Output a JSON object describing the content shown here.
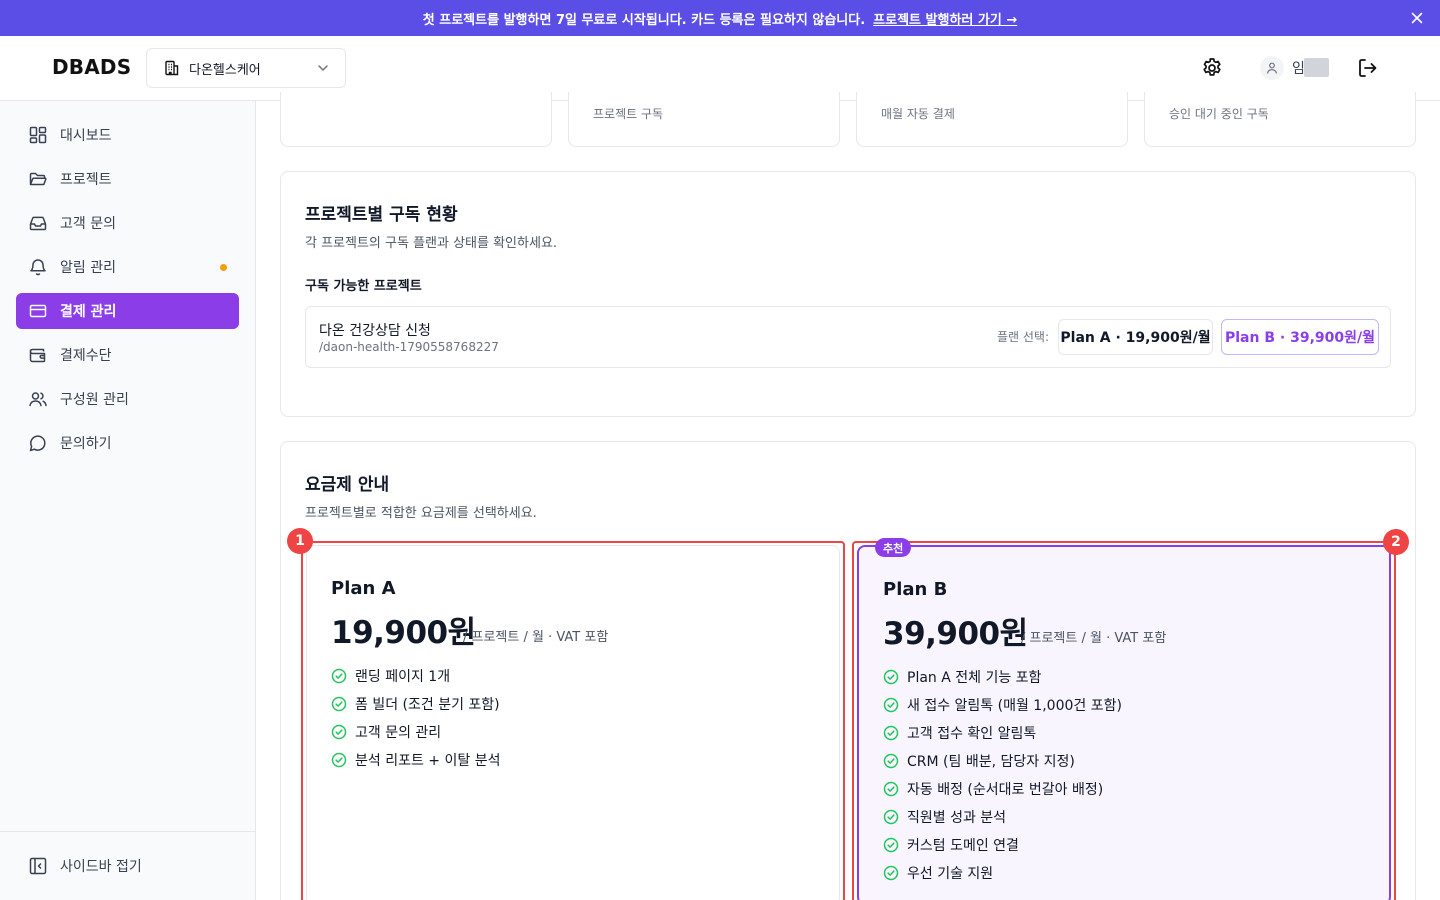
{
  "banner": {
    "text": "첫 프로젝트를 발행하면 7일 무료로 시작됩니다. 카드 등록은 필요하지 않습니다.",
    "link": "프로젝트 발행하러 가기 →",
    "close_icon": "close-icon"
  },
  "header": {
    "logo": "DBADS",
    "org_name": "다온헬스케어",
    "user_initial": "임"
  },
  "sidebar": {
    "items": [
      {
        "label": "대시보드",
        "icon": "dashboard-icon"
      },
      {
        "label": "프로젝트",
        "icon": "folder-icon"
      },
      {
        "label": "고객 문의",
        "icon": "inbox-icon"
      },
      {
        "label": "알림 관리",
        "icon": "bell-icon"
      },
      {
        "label": "결제 관리",
        "icon": "credit-card-icon"
      },
      {
        "label": "결제수단",
        "icon": "wallet-icon"
      },
      {
        "label": "구성원 관리",
        "icon": "users-icon"
      },
      {
        "label": "문의하기",
        "icon": "chat-icon"
      }
    ],
    "active_index": 4,
    "collapse_label": "사이드바 접기"
  },
  "stats": [
    {
      "desc": ""
    },
    {
      "desc": "프로젝트 구독"
    },
    {
      "desc": "매월 자동 결제"
    },
    {
      "desc": "승인 대기 중인 구독"
    }
  ],
  "subscriptions": {
    "title": "프로젝트별 구독 현황",
    "desc": "각 프로젝트의 구독 플랜과 상태를 확인하세요.",
    "subtitle": "구독 가능한 프로젝트",
    "project": {
      "name": "다온 건강상담 신청",
      "slug": "/daon-health-1790558768227",
      "plan_label": "플랜 선택:",
      "plan_a": "Plan A · 19,900원/월",
      "plan_b": "Plan B · 39,900원/월"
    }
  },
  "pricing": {
    "title": "요금제 안내",
    "desc": "프로젝트별로 적합한 요금제를 선택하세요.",
    "plans": [
      {
        "name": "Plan A",
        "price": "19,900원",
        "unit": "/ 프로젝트 / 월 · VAT 포함",
        "badge_num": "1",
        "features": [
          "랜딩 페이지 1개",
          "폼 빌더 (조건 분기 포함)",
          "고객 문의 관리",
          "분석 리포트 + 이탈 분석"
        ]
      },
      {
        "name": "Plan B",
        "price": "39,900원",
        "unit": "/ 프로젝트 / 월 · VAT 포함",
        "badge_num": "2",
        "recommended": "추천",
        "features": [
          "Plan A 전체 기능 포함",
          "새 접수 알림톡 (매월 1,000건 포함)",
          "고객 접수 확인 알림톡",
          "CRM (팀 배분, 담당자 지정)",
          "자동 배정 (순서대로 번갈아 배정)",
          "직원별 성과 분석",
          "커스텀 도메인 연결",
          "우선 기술 지원"
        ]
      }
    ]
  },
  "colors": {
    "banner": "#5b4ee6",
    "accent": "#8b3ee8",
    "annotation": "#ef4444",
    "check": "#22c55e",
    "notify_dot": "#f59e0b"
  }
}
